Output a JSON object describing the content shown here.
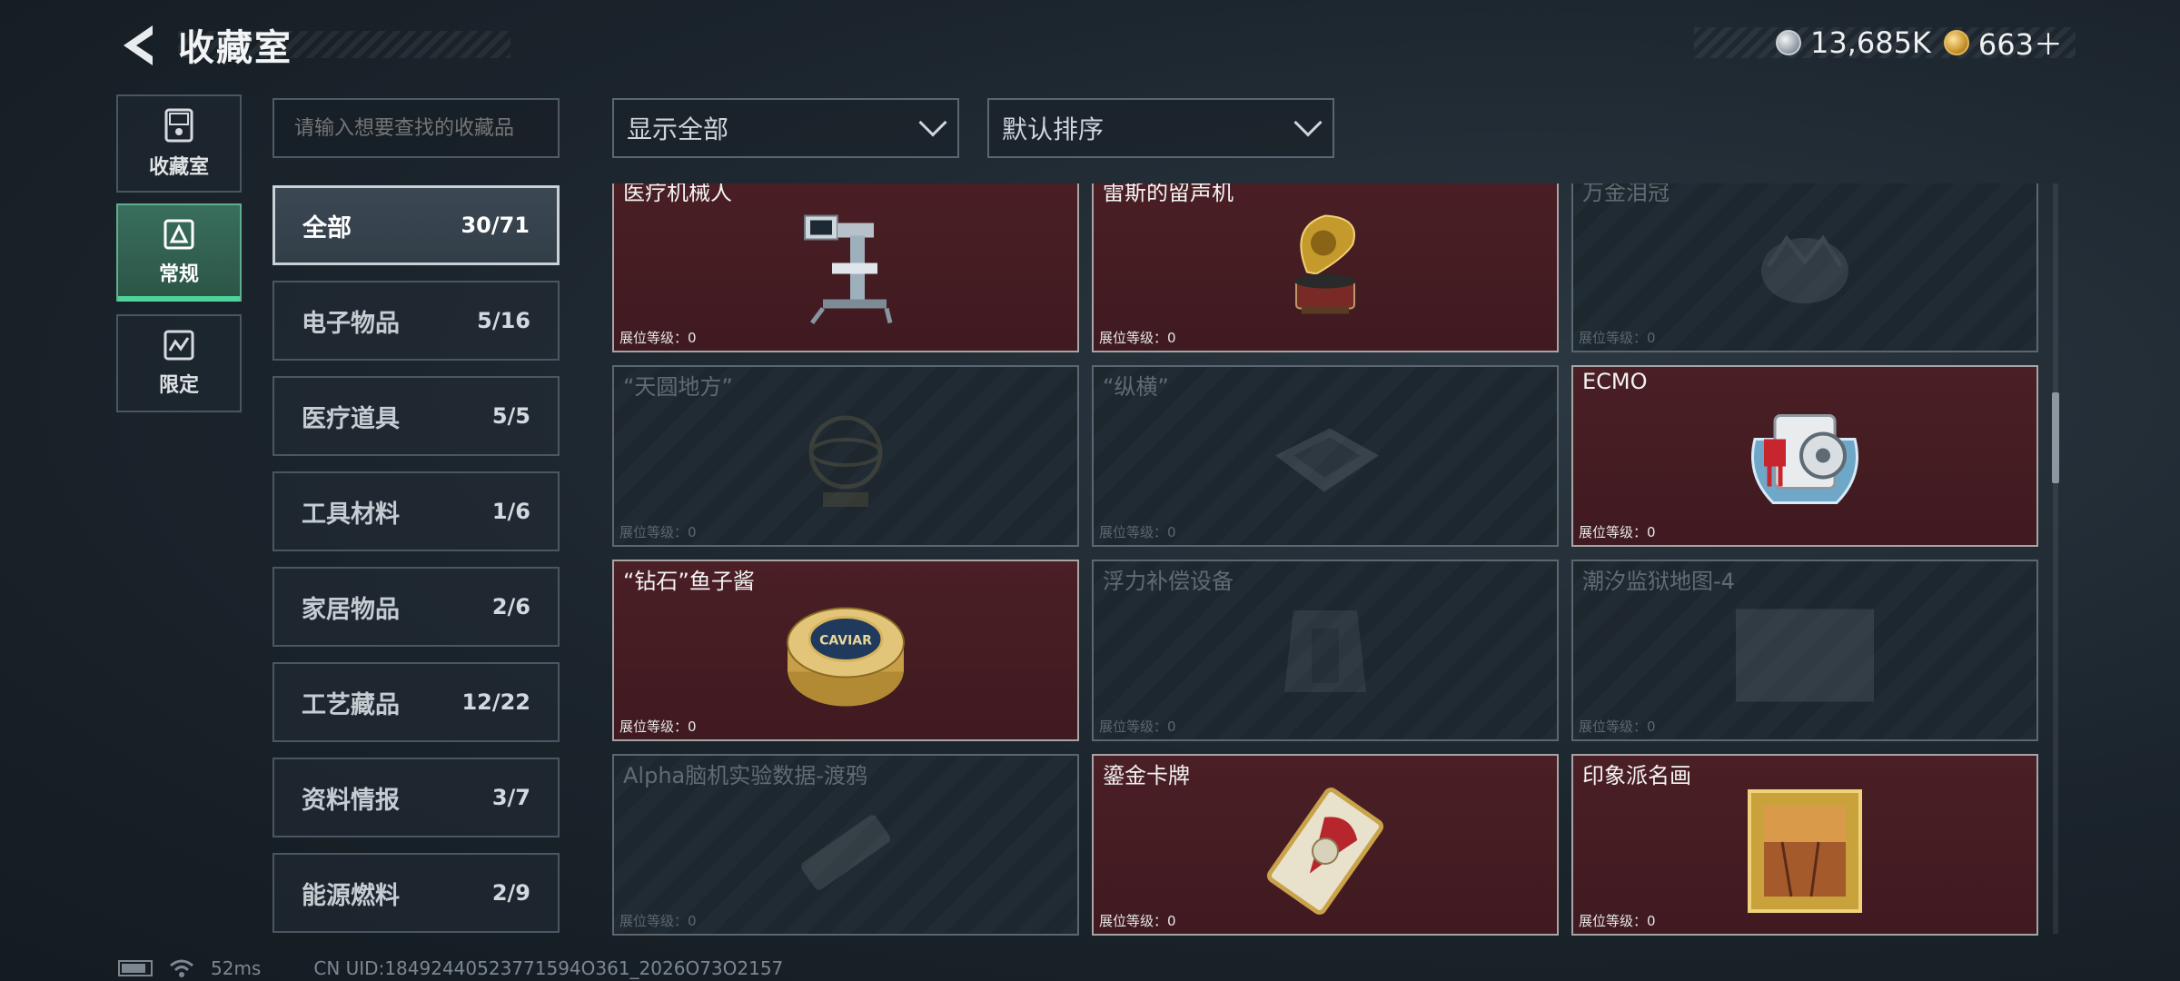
{
  "header": {
    "title": "收藏室",
    "currencies": [
      {
        "icon": "silver-coin-icon",
        "value": "13,685K"
      },
      {
        "icon": "gold-coin-icon",
        "value": "663＋"
      }
    ]
  },
  "mode_tabs": [
    {
      "label": "收藏室",
      "icon": "collection-room-icon",
      "active": false
    },
    {
      "label": "常规",
      "icon": "regular-icon",
      "active": true
    },
    {
      "label": "限定",
      "icon": "limited-icon",
      "active": false
    }
  ],
  "search": {
    "placeholder": "请输入想要查找的收藏品"
  },
  "categories": [
    {
      "name": "全部",
      "count": "30/71",
      "active": true
    },
    {
      "name": "电子物品",
      "count": "5/16"
    },
    {
      "name": "医疗道具",
      "count": "5/5"
    },
    {
      "name": "工具材料",
      "count": "1/6"
    },
    {
      "name": "家居物品",
      "count": "2/6"
    },
    {
      "name": "工艺藏品",
      "count": "12/22"
    },
    {
      "name": "资料情报",
      "count": "3/7"
    },
    {
      "name": "能源燃料",
      "count": "2/9"
    }
  ],
  "filters": {
    "display": "显示全部",
    "sort": "默认排序"
  },
  "items": [
    {
      "name": "医疗机械人",
      "level": "展位等级：0",
      "owned": true,
      "icon": "medical-robot-icon"
    },
    {
      "name": "雷斯的留声机",
      "level": "展位等级：0",
      "owned": true,
      "icon": "gramophone-icon"
    },
    {
      "name": "万金泪冠",
      "level": "展位等级：0",
      "owned": false,
      "icon": "crown-icon"
    },
    {
      "name": "“天圆地方”",
      "level": "展位等级：0",
      "owned": false,
      "icon": "armillary-icon"
    },
    {
      "name": "“纵横”",
      "level": "展位等级：0",
      "owned": false,
      "icon": "chessboard-icon"
    },
    {
      "name": "ECMO",
      "level": "展位等级：0",
      "owned": true,
      "icon": "ecmo-machine-icon"
    },
    {
      "name": "“钻石”鱼子酱",
      "level": "展位等级：0",
      "owned": true,
      "icon": "caviar-tin-icon",
      "tin_text": "CAVIAR"
    },
    {
      "name": "浮力补偿设备",
      "level": "展位等级：0",
      "owned": false,
      "icon": "bcd-vest-icon"
    },
    {
      "name": "潮汐监狱地图-4",
      "level": "展位等级：0",
      "owned": false,
      "icon": "map-icon"
    },
    {
      "name": "Alpha脑机实验数据-渡鸦",
      "level": "展位等级：0",
      "owned": false,
      "icon": "usb-drive-icon"
    },
    {
      "name": "鎏金卡牌",
      "level": "展位等级：0",
      "owned": true,
      "icon": "gilded-card-icon"
    },
    {
      "name": "印象派名画",
      "level": "展位等级：0",
      "owned": true,
      "icon": "painting-icon"
    }
  ],
  "footer": {
    "ping": "52ms",
    "uid": "CN UID:18492440523771594O361_2026O73O2157"
  }
}
